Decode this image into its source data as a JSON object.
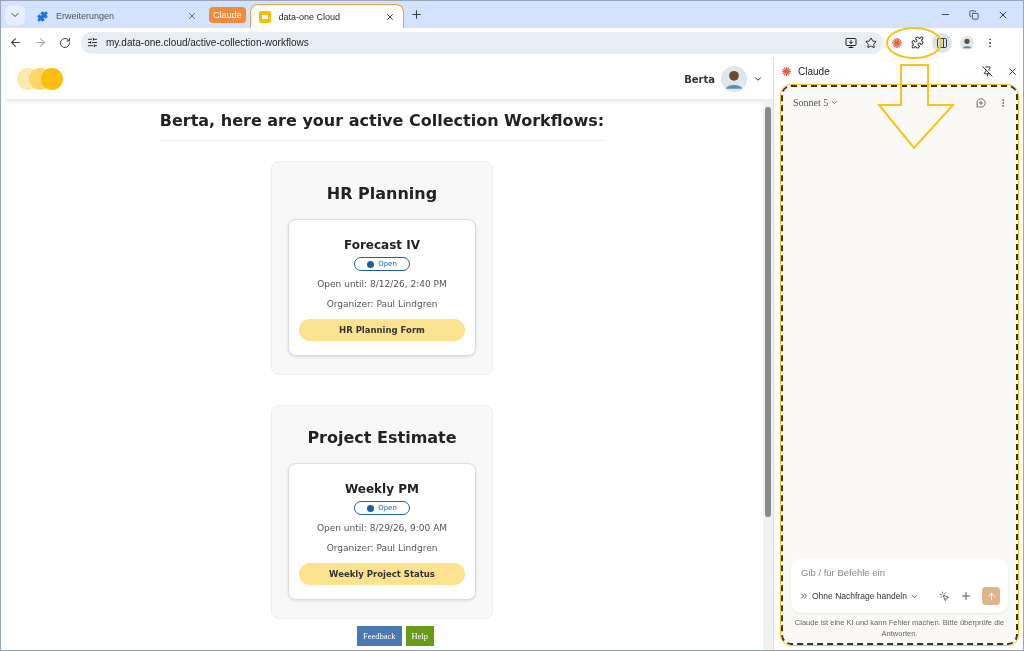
{
  "browser": {
    "tabs": [
      {
        "label": "Erweiterungen",
        "selected": false,
        "kind": "extensions"
      },
      {
        "label": "data-one Cloud",
        "selected": true,
        "kind": "site"
      }
    ],
    "tab_group": "Claude",
    "url": "my.data-one.cloud/active-collection-workflows"
  },
  "page": {
    "user": "Berta",
    "heading": "Berta, here are your active Collection Workflows:",
    "workflows": [
      {
        "title": "HR Planning",
        "items": [
          {
            "name": "Forecast IV",
            "status": "Open",
            "open_until": "Open until: 8/12/26, 2:40 PM",
            "organizer": "Organizer: Paul Lindgren",
            "button": "HR Planning Form"
          }
        ]
      },
      {
        "title": "Project Estimate",
        "items": [
          {
            "name": "Weekly PM",
            "status": "Open",
            "open_until": "Open until: 8/29/26, 9:00 AM",
            "organizer": "Organizer: Paul Lindgren",
            "button": "Weekly Project Status"
          }
        ]
      }
    ],
    "floating_buttons": [
      {
        "label": "Feedback",
        "kind": "feedback"
      },
      {
        "label": "Help",
        "kind": "help"
      }
    ]
  },
  "side_panel": {
    "title": "Claude",
    "model": "Sonnet 5",
    "input": {
      "placeholder": "Gib / für Befehle ein"
    },
    "mode": "Ohne Nachfrage handeln",
    "disclaimer": "Claude ist eine KI und kann Fehler machen. Bitte überprüfe die Antworten."
  }
}
